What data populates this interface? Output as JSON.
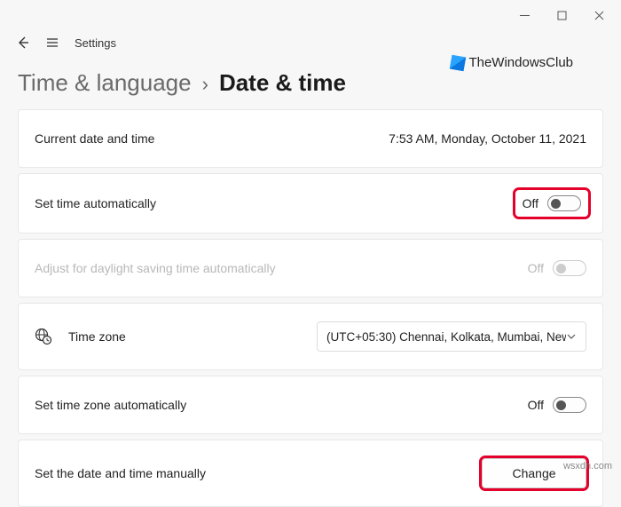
{
  "window": {
    "app_name": "Settings"
  },
  "breadcrumb": {
    "parent": "Time & language",
    "separator": "›",
    "current": "Date & time"
  },
  "brand": {
    "text": "TheWindowsClub"
  },
  "rows": {
    "current": {
      "label": "Current date and time",
      "value": "7:53 AM, Monday, October 11, 2021"
    },
    "auto_time": {
      "label": "Set time automatically",
      "state": "Off"
    },
    "dst": {
      "label": "Adjust for daylight saving time automatically",
      "state": "Off"
    },
    "timezone": {
      "label": "Time zone",
      "selected": "(UTC+05:30) Chennai, Kolkata, Mumbai, New"
    },
    "auto_tz": {
      "label": "Set time zone automatically",
      "state": "Off"
    },
    "manual": {
      "label": "Set the date and time manually",
      "button": "Change"
    }
  },
  "watermark": "wsxdn.com"
}
